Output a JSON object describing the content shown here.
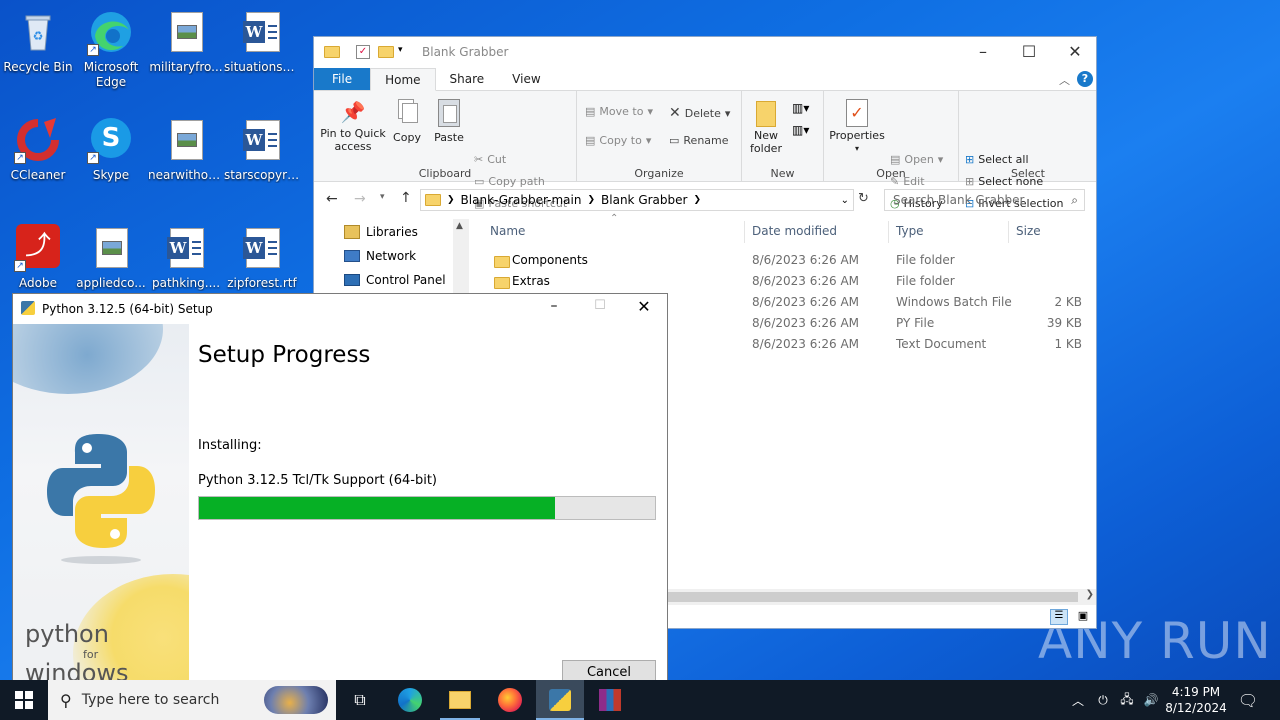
{
  "desktop": {
    "icons": [
      {
        "label": "Recycle Bin"
      },
      {
        "label": "Microsoft Edge"
      },
      {
        "label": "militaryfro..."
      },
      {
        "label": "situationsh..."
      },
      {
        "label": "CCleaner"
      },
      {
        "label": "Skype"
      },
      {
        "label": "nearwithou..."
      },
      {
        "label": "starscopyri..."
      },
      {
        "label": "Adobe"
      },
      {
        "label": "appliedco..."
      },
      {
        "label": "pathking...."
      },
      {
        "label": "zipforest.rtf"
      }
    ],
    "watermark": "ANY RUN"
  },
  "explorer": {
    "title": "Blank Grabber",
    "tabs": [
      "File",
      "Home",
      "Share",
      "View"
    ],
    "clipboard": {
      "pin": "Pin to Quick access",
      "copy": "Copy",
      "paste": "Paste",
      "cut": "Cut",
      "copy_path": "Copy path",
      "paste_shortcut": "Paste shortcut",
      "label": "Clipboard"
    },
    "organize": {
      "move_to": "Move to",
      "copy_to": "Copy to",
      "delete": "Delete",
      "rename": "Rename",
      "label": "Organize"
    },
    "new": {
      "new_folder": "New folder",
      "label": "New"
    },
    "open": {
      "properties": "Properties",
      "open": "Open",
      "edit": "Edit",
      "history": "History",
      "label": "Open"
    },
    "select": {
      "select_all": "Select all",
      "select_none": "Select none",
      "invert": "Invert selection",
      "label": "Select"
    },
    "path": [
      "Blank-Grabber-main",
      "Blank Grabber"
    ],
    "search_placeholder": "Search Blank Grabber",
    "nav": [
      "Libraries",
      "Network",
      "Control Panel"
    ],
    "columns": {
      "name": "Name",
      "date": "Date modified",
      "type": "Type",
      "size": "Size"
    },
    "files": [
      {
        "name": "Components",
        "date": "8/6/2023 6:26 AM",
        "type": "File folder",
        "size": ""
      },
      {
        "name": "Extras",
        "date": "8/6/2023 6:26 AM",
        "type": "File folder",
        "size": ""
      },
      {
        "name": "",
        "date": "8/6/2023 6:26 AM",
        "type": "Windows Batch File",
        "size": "2 KB"
      },
      {
        "name": "",
        "date": "8/6/2023 6:26 AM",
        "type": "PY File",
        "size": "39 KB"
      },
      {
        "name": "",
        "date": "8/6/2023 6:26 AM",
        "type": "Text Document",
        "size": "1 KB"
      }
    ]
  },
  "setup": {
    "title": "Python 3.12.5 (64-bit) Setup",
    "heading": "Setup Progress",
    "installing_label": "Installing:",
    "component": "Python 3.12.5 Tcl/Tk Support (64-bit)",
    "progress": 0.78,
    "cancel": "Cancel",
    "brand_line1": "python",
    "brand_line2": "for",
    "brand_line3": "windows"
  },
  "taskbar": {
    "search_placeholder": "Type here to search",
    "time": "4:19 PM",
    "date": "8/12/2024"
  }
}
